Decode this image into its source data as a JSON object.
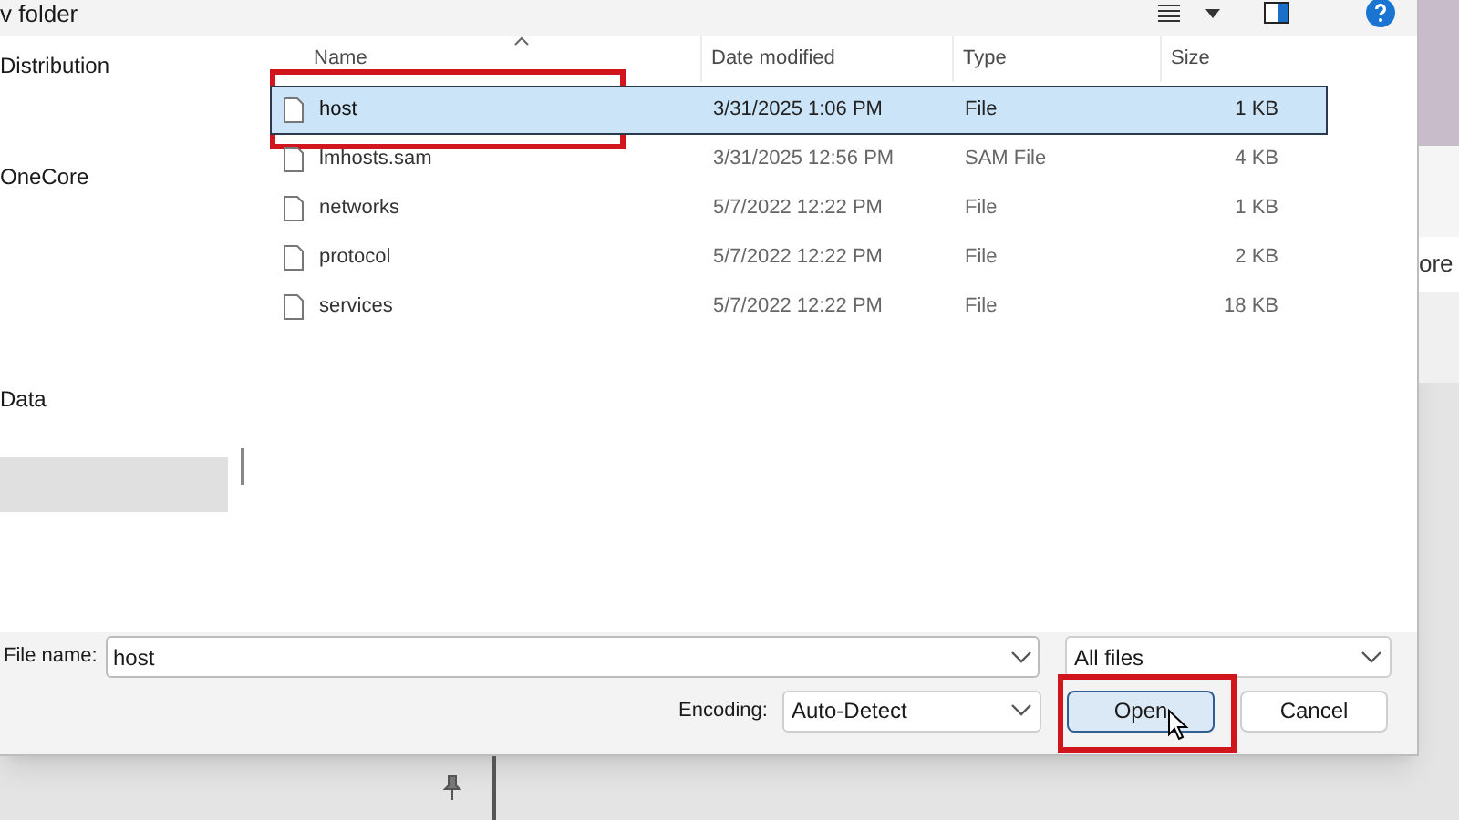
{
  "window": {
    "title": "v folder"
  },
  "nav": {
    "items": [
      {
        "label": "Distribution",
        "selected": false
      },
      {
        "label": "OneCore",
        "selected": false
      },
      {
        "label": "Data",
        "selected": false
      },
      {
        "selected": true
      }
    ]
  },
  "table": {
    "columns": [
      "Name",
      "Date modified",
      "Type",
      "Size"
    ],
    "rows": [
      {
        "name": "host",
        "date": "3/31/2025 1:06 PM",
        "type": "File",
        "size": "1 KB",
        "selected": true,
        "highlighted": true
      },
      {
        "name": "lmhosts.sam",
        "date": "3/31/2025 12:56 PM",
        "type": "SAM File",
        "size": "4 KB",
        "selected": false,
        "highlighted": false
      },
      {
        "name": "networks",
        "date": "5/7/2022 12:22 PM",
        "type": "File",
        "size": "1 KB",
        "selected": false,
        "highlighted": false
      },
      {
        "name": "protocol",
        "date": "5/7/2022 12:22 PM",
        "type": "File",
        "size": "2 KB",
        "selected": false,
        "highlighted": false
      },
      {
        "name": "services",
        "date": "5/7/2022 12:22 PM",
        "type": "File",
        "size": "18 KB",
        "selected": false,
        "highlighted": false
      }
    ]
  },
  "file_name": {
    "label": "File name:",
    "value": "host"
  },
  "file_type": {
    "value": "All files"
  },
  "encoding": {
    "label": "Encoding:",
    "value": "Auto-Detect"
  },
  "buttons": [
    {
      "label": "Open",
      "highlighted": true
    },
    {
      "label": "Cancel",
      "highlighted": false
    }
  ],
  "background": {
    "text": "ore"
  }
}
